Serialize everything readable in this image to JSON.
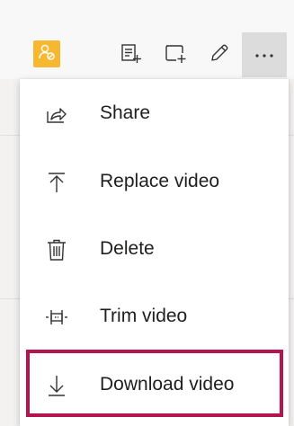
{
  "toolbar": {
    "avatar_icon": "user-blocked-icon",
    "buttons": [
      {
        "icon": "add-note-icon"
      },
      {
        "icon": "add-shape-icon"
      },
      {
        "icon": "pencil-icon"
      },
      {
        "icon": "more-icon",
        "text": "···"
      }
    ]
  },
  "menu": {
    "items": [
      {
        "label": "Share",
        "icon": "share-icon"
      },
      {
        "label": "Replace video",
        "icon": "upload-icon"
      },
      {
        "label": "Delete",
        "icon": "trash-icon"
      },
      {
        "label": "Trim video",
        "icon": "trim-icon"
      },
      {
        "label": "Download video",
        "icon": "download-icon",
        "highlighted": true
      }
    ]
  },
  "colors": {
    "avatar": "#f7b831",
    "highlight_border": "#b4154f",
    "text": "#201f1e",
    "more_button_bg": "#dcdcdc"
  }
}
